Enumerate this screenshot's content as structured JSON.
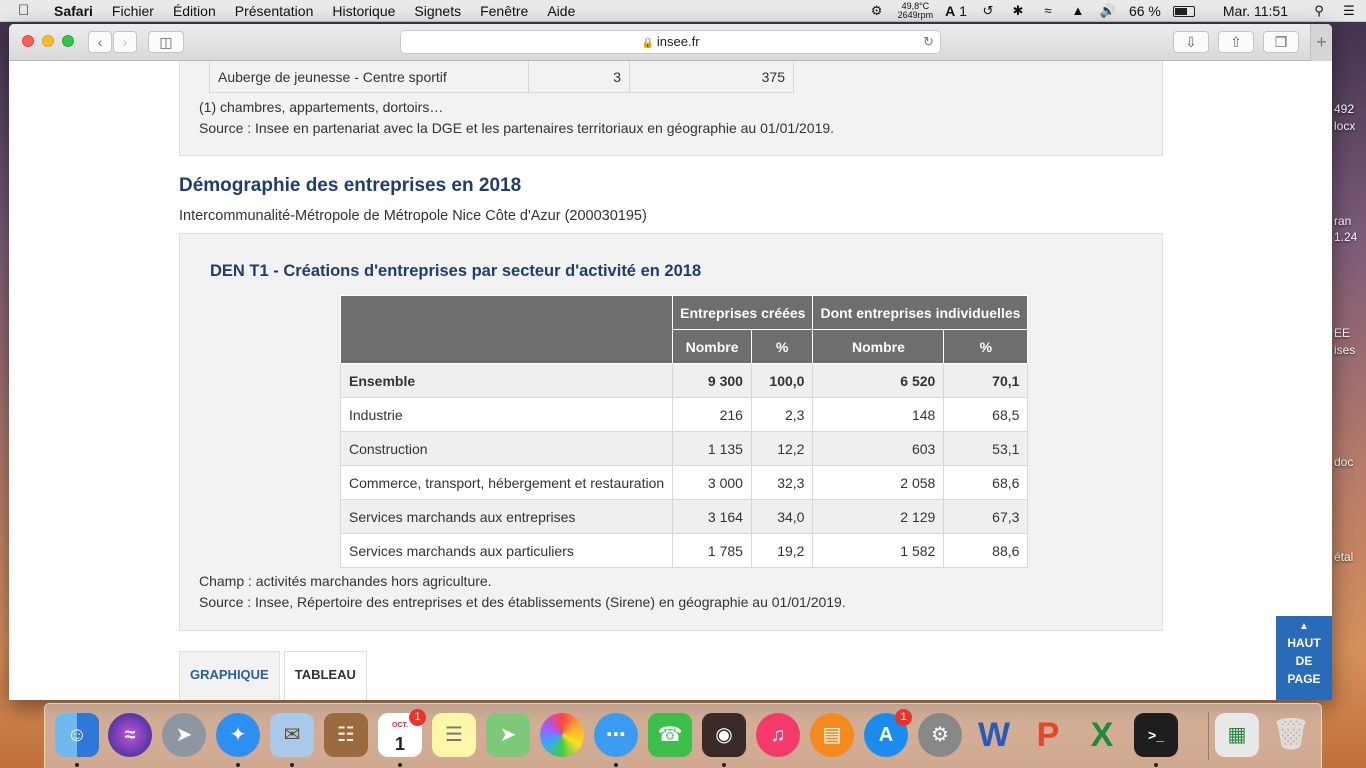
{
  "menubar": {
    "items": [
      "Safari",
      "Fichier",
      "Édition",
      "Présentation",
      "Historique",
      "Signets",
      "Fenêtre",
      "Aide"
    ],
    "temp": "49,8°C",
    "rpm": "2649rpm",
    "adobe_count": "1",
    "battery": "66 %",
    "battery_level": 0.66,
    "clock": "Mar. 11:51"
  },
  "browser": {
    "url": "insee.fr"
  },
  "previous": {
    "row": [
      "Auberge de jeunesse - Centre sportif",
      "3",
      "375"
    ],
    "note1": "(1) chambres, appartements, dortoirs…",
    "source": "Source : Insee en partenariat avec la DGE et les partenaires territoriaux en géographie au 01/01/2019."
  },
  "section": {
    "title": "Démographie des entreprises en 2018",
    "subtitle": "Intercommunalité-Métropole de Métropole Nice Côte d'Azur (200030195)"
  },
  "table": {
    "title": "DEN T1 - Créations d'entreprises par secteur d'activité en 2018",
    "group_headers": [
      "Entreprises créées",
      "Dont entreprises individuelles"
    ],
    "sub_headers": [
      "Nombre",
      "%",
      "Nombre",
      "%"
    ],
    "rows": [
      {
        "label": "Ensemble",
        "v1": "9 300",
        "p1": "100,0",
        "v2": "6 520",
        "p2": "70,1"
      },
      {
        "label": "Industrie",
        "v1": "216",
        "p1": "2,3",
        "v2": "148",
        "p2": "68,5"
      },
      {
        "label": "Construction",
        "v1": "1 135",
        "p1": "12,2",
        "v2": "603",
        "p2": "53,1"
      },
      {
        "label": "Commerce, transport, hébergement et restauration",
        "v1": "3 000",
        "p1": "32,3",
        "v2": "2 058",
        "p2": "68,6"
      },
      {
        "label": "Services marchands aux entreprises",
        "v1": "3 164",
        "p1": "34,0",
        "v2": "2 129",
        "p2": "67,3"
      },
      {
        "label": "Services marchands aux particuliers",
        "v1": "1 785",
        "p1": "19,2",
        "v2": "1 582",
        "p2": "88,6"
      }
    ],
    "champ": "Champ : activités marchandes hors agriculture.",
    "source": "Source : Insee, Répertoire des entreprises et des établissements (Sirene) en géographie au 01/01/2019."
  },
  "tabs": [
    "GRAPHIQUE",
    "TABLEAU"
  ],
  "haut_de_page": [
    "HAUT",
    "DE",
    "PAGE"
  ],
  "desktop_fragments": [
    "492",
    "locx",
    "ran",
    "1.24",
    "EE",
    "ises",
    "doc",
    "étal"
  ],
  "dock": {
    "calendar_month": "OCT.",
    "calendar_day": "1",
    "calendar_badge": "1",
    "appstore_badge": "1"
  }
}
